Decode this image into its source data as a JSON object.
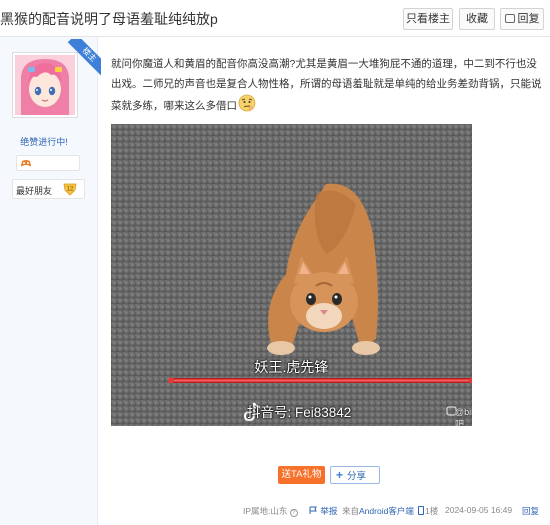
{
  "thread": {
    "title": "黑猴的配音说明了母语羞耻纯纯放p",
    "buttons": {
      "only_op": "只看楼主",
      "favorite": "收藏",
      "reply": "回复"
    }
  },
  "author": {
    "username": "绝赞进行中!",
    "role_ribbon": "楼主",
    "sign_label": "最好朋友",
    "sign_level": "12"
  },
  "post": {
    "text": "就问你魔道人和黄眉的配音你高没高潮?尤其是黄眉一大堆狗屁不通的道理，中二到不行也没出戏。二师兄的声音也是复合人物性格，所谓的母语羞耻就是单纯的给业务差劲背锅，只能说菜就多练，哪来这么多借口",
    "gif": {
      "caption_name": "妖王.虎先锋",
      "caption_douyin": "抖音号: Fei83842",
      "watermark": "@bilibili吧"
    },
    "gift_button": "送TA礼物",
    "share_button": "分享"
  },
  "footer": {
    "ip_location": "IP属地:山东",
    "report": "举报",
    "client_prefix": "来自",
    "client": "Android客户端",
    "floor": "1楼",
    "timestamp": "2024-09-05 16:49",
    "reply_label": "回复"
  },
  "colors": {
    "link": "#2d64b3",
    "gift": "#f7712a",
    "ribbon": "#3e7fd9",
    "sidebar_bg": "#f5f8fd"
  }
}
